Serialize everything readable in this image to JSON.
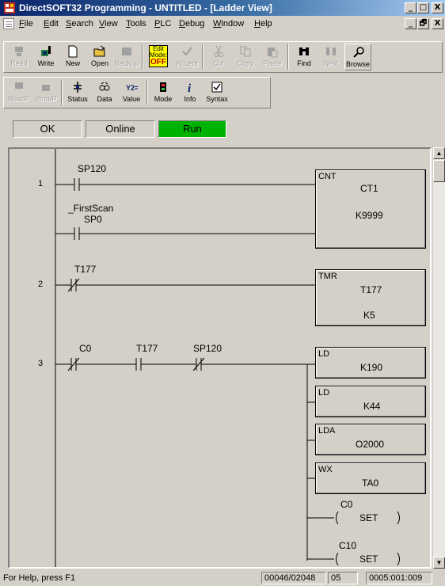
{
  "window": {
    "title": "DirectSOFT32 Programming - UNTITLED - [Ladder View]",
    "caption_buttons": [
      "_",
      "□",
      "X"
    ],
    "mdi_buttons": [
      "_",
      "🗗",
      "X"
    ]
  },
  "menu": {
    "items": [
      {
        "key": "F",
        "rest": "ile"
      },
      {
        "key": "E",
        "rest": "dit"
      },
      {
        "key": "S",
        "rest": "earch"
      },
      {
        "key": "V",
        "rest": "iew"
      },
      {
        "key": "T",
        "rest": "ools"
      },
      {
        "key": "P",
        "rest": "LC"
      },
      {
        "key": "D",
        "rest": "ebug"
      },
      {
        "key": "W",
        "rest": "indow"
      },
      {
        "key": "H",
        "rest": "elp"
      }
    ]
  },
  "toolbar1": {
    "buttons": [
      {
        "label": "Read",
        "icon": "read-plc-icon",
        "enabled": false
      },
      {
        "label": "Write",
        "icon": "write-plc-icon",
        "enabled": true
      },
      {
        "label": "New",
        "icon": "new-document-icon",
        "enabled": true
      },
      {
        "label": "Open",
        "icon": "open-folder-icon",
        "enabled": true
      },
      {
        "label": "Backup",
        "icon": "backup-icon",
        "enabled": false
      },
      {
        "label": "Edit Mode: OFF",
        "icon": "edit-mode-icon",
        "enabled": true
      },
      {
        "label": "Accept",
        "icon": "accept-icon",
        "enabled": false
      },
      {
        "label": "Cut",
        "icon": "scissors-icon",
        "enabled": false
      },
      {
        "label": "Copy",
        "icon": "copy-icon",
        "enabled": false
      },
      {
        "label": "Paste",
        "icon": "paste-icon",
        "enabled": false
      },
      {
        "label": "Find",
        "icon": "binoculars-icon",
        "enabled": true
      },
      {
        "label": "Next",
        "icon": "find-next-icon",
        "enabled": false
      },
      {
        "label": "Browse",
        "icon": "browse-icon",
        "enabled": true
      }
    ],
    "edit_mode": {
      "line1": "Edit",
      "line2": "Mode:",
      "line3": "OFF"
    }
  },
  "toolbar2": {
    "buttons": [
      {
        "label": "ReadP",
        "icon": "read-program-icon",
        "enabled": false
      },
      {
        "label": "WriteP",
        "icon": "write-program-icon",
        "enabled": false
      },
      {
        "label": "Status",
        "icon": "status-icon",
        "enabled": true
      },
      {
        "label": "Data",
        "icon": "data-view-icon",
        "enabled": true
      },
      {
        "label": "Value",
        "icon": "value-icon",
        "enabled": true
      },
      {
        "label": "Mode",
        "icon": "plc-mode-icon",
        "enabled": true
      },
      {
        "label": "Info",
        "icon": "info-icon",
        "enabled": true
      },
      {
        "label": "Syntax",
        "icon": "syntax-check-icon",
        "enabled": true
      }
    ]
  },
  "status": {
    "ok": "OK",
    "online": "Online",
    "run": "Run",
    "run_color": "#00b300"
  },
  "ladder": {
    "rungs": [
      {
        "number": "1",
        "contacts": [
          {
            "label": "SP120",
            "type": "normally-open"
          },
          {
            "label1": "_FirstScan",
            "label2": "SP0",
            "type": "normally-open"
          }
        ],
        "box": {
          "type": "CNT",
          "value1": "CT1",
          "value2": "K9999"
        }
      },
      {
        "number": "2",
        "contacts": [
          {
            "label": "T177",
            "type": "normally-closed"
          }
        ],
        "box": {
          "type": "TMR",
          "value1": "T177",
          "value2": "K5"
        }
      },
      {
        "number": "3",
        "contacts": [
          {
            "label": "C0",
            "type": "normally-closed"
          },
          {
            "label": "T177",
            "type": "normally-open"
          },
          {
            "label": "SP120",
            "type": "normally-closed"
          }
        ],
        "boxes": [
          {
            "type": "LD",
            "value": "K190"
          },
          {
            "type": "LD",
            "value": "K44"
          },
          {
            "type": "LDA",
            "value": "O2000"
          },
          {
            "type": "WX",
            "value": "TA0"
          }
        ],
        "coils": [
          {
            "address": "C0",
            "instruction": "SET"
          },
          {
            "address": "C10",
            "instruction": "SET"
          }
        ]
      }
    ]
  },
  "statusbar": {
    "help": "For Help, press F1",
    "memory": "00046/02048",
    "column": "05",
    "position": "0005:001:009"
  }
}
